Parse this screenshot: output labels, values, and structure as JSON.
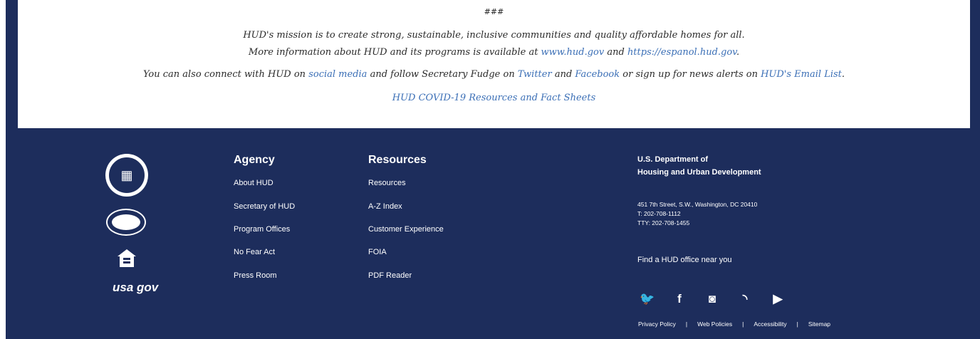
{
  "press": {
    "hash": "###",
    "mission_line": "HUD's mission is to create strong, sustainable, inclusive communities and quality affordable homes for all.",
    "info_prefix": "More information about HUD and its programs is available at ",
    "info_link1": "www.hud.gov",
    "info_and": " and ",
    "info_link2": "https://espanol.hud.gov",
    "info_suffix": ".",
    "connect_prefix": "You can also connect with HUD on ",
    "connect_social": "social media",
    "connect_mid1": " and follow Secretary Fudge on ",
    "connect_twitter": "Twitter",
    "connect_mid2": " and ",
    "connect_facebook": "Facebook",
    "connect_mid3": " or sign up for news alerts on ",
    "connect_email": "HUD's Email List",
    "connect_suffix": ".",
    "covid_link": "HUD COVID-19 Resources and Fact Sheets"
  },
  "footer": {
    "agency": {
      "heading": "Agency",
      "links": [
        "About HUD",
        "Secretary of HUD",
        "Program Offices",
        "No Fear Act",
        "Press Room"
      ]
    },
    "resources": {
      "heading": "Resources",
      "links": [
        "Resources",
        "A-Z Index",
        "Customer Experience",
        "FOIA",
        "PDF Reader"
      ]
    },
    "dept_line1": "U.S. Department of",
    "dept_line2": "Housing and Urban Development",
    "address": "451 7th Street, S.W., Washington, DC 20410",
    "phone": "T: 202-708-1112",
    "tty": "TTY: 202-708-1455",
    "find_office": "Find a HUD office near you",
    "usa_gov": "usa gov",
    "legal": [
      "Privacy Policy",
      "Web Policies",
      "Accessibility",
      "Sitemap"
    ],
    "separator": "|",
    "social_icons": [
      "twitter-icon",
      "facebook-icon",
      "instagram-icon",
      "rss-icon",
      "youtube-icon"
    ]
  },
  "colors": {
    "navy": "#1d2d5c",
    "link": "#3b6fb6"
  }
}
